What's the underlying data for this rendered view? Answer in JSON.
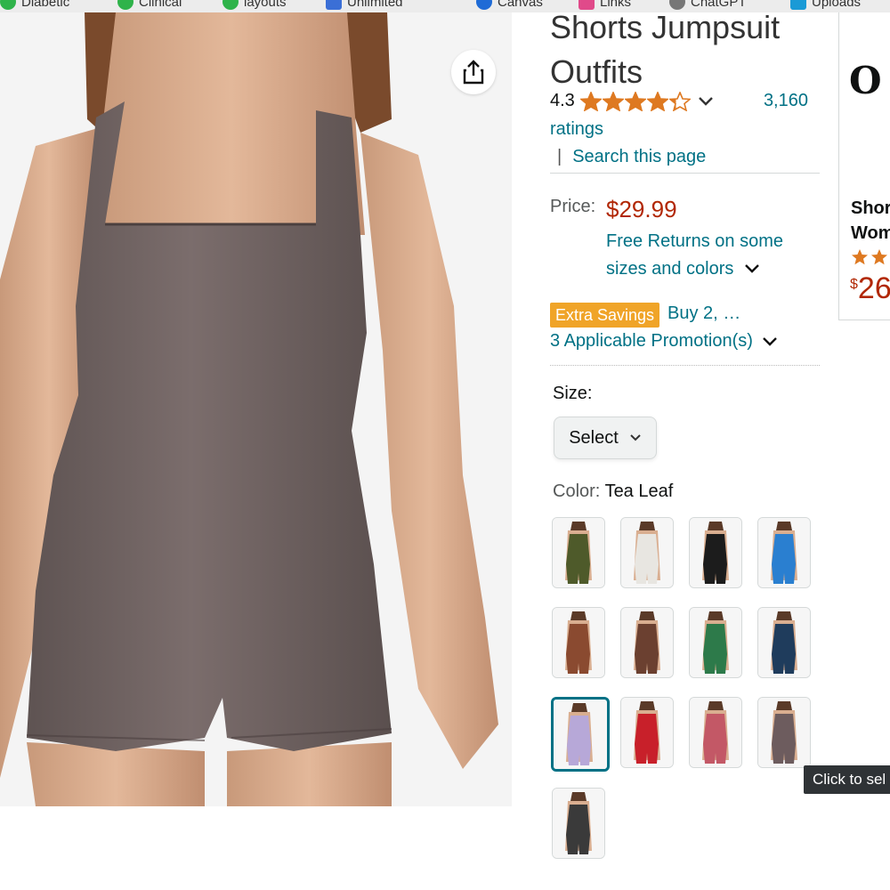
{
  "product": {
    "title_line1": "Shorts Jumpsuit",
    "title_line2": "Outfits",
    "rating_value": "4.3",
    "rating_stars": 4.3,
    "rating_count": "3,160",
    "ratings_word": "ratings",
    "search_page_link": "Search this page",
    "price_label": "Price:",
    "price_value": "$29.99",
    "returns_text": "Free Returns on some sizes and colors",
    "promo_badge": "Extra Savings",
    "promo_text": "Buy 2, …",
    "promotions_link": "3 Applicable Promotion(s)",
    "size_label": "Size:",
    "size_select_value": "Select",
    "color_label_key": "Color:",
    "color_label_value": "Tea Leaf",
    "tooltip_text": "Click to sel"
  },
  "swatch_colors": [
    "#4e5a2a",
    "#e8e6e1",
    "#1c1c1c",
    "#2a7fd0",
    "#8a4a30",
    "#6b4030",
    "#2d7a4a",
    "#1f3c5c",
    "#b7a8d8",
    "#c8202a",
    "#c35866",
    "#6d5c5e",
    "#3a3a3a"
  ],
  "sponsored": {
    "title_line1": "Shor",
    "title_line2": "Wom",
    "price_symbol": "$",
    "price_digits": "26"
  },
  "bookmarks": {
    "items": [
      {
        "label": "Diabetic",
        "color": "#2fb34a"
      },
      {
        "label": "Clinical",
        "color": "#2fb34a"
      },
      {
        "label": "layouts",
        "color": "#2fb34a"
      },
      {
        "label": "Unlimited",
        "color": "#3b6fd6"
      },
      {
        "label": "Canvas",
        "color": "#1f6bd6"
      },
      {
        "label": "Links",
        "color": "#e04a8a"
      },
      {
        "label": "ChatGPT",
        "color": "#777777"
      },
      {
        "label": "Uploads",
        "color": "#1a9ad6"
      }
    ]
  },
  "colors": {
    "link": "#007185",
    "price": "#b12704",
    "star": "#de7921",
    "badge": "#f0a428"
  }
}
